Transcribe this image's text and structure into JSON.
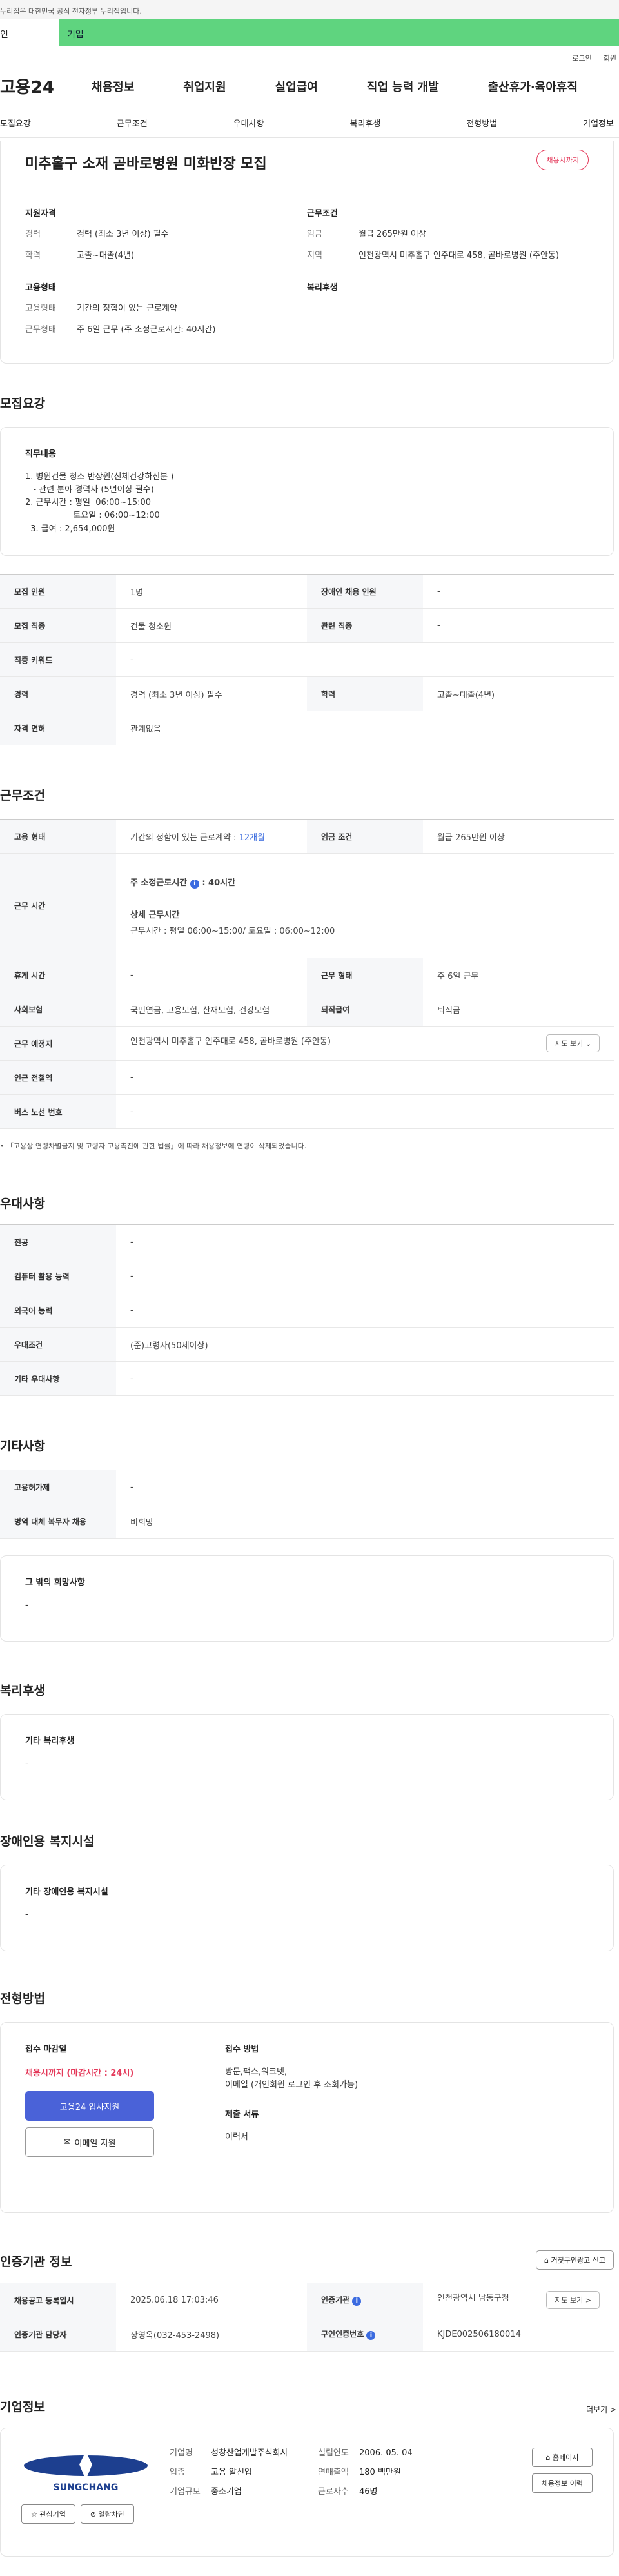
{
  "gov_notice": "누리집은 대한민국 공식 전자정부 누리집입니다.",
  "top_tabs": {
    "individual": "인",
    "corporate": "기업"
  },
  "auth_links": {
    "login": "로그인",
    "signup": "회원"
  },
  "brand": "고용24",
  "main_nav": [
    "채용정보",
    "취업지원",
    "실업급여",
    "직업 능력 개발",
    "출산휴가·육아휴직"
  ],
  "sub_nav": [
    "모집요강",
    "근무조건",
    "우대사항",
    "복리후생",
    "전형방법",
    "기업정보"
  ],
  "summary": {
    "title": "미추홀구 소재 곧바로병원 미화반장 모집",
    "badge": "채용시까지",
    "qual_head": "지원자격",
    "career_k": "경력",
    "career_v": "경력 (최소 3년 이상) 필수",
    "edu_k": "학력",
    "edu_v": "고졸~대졸(4년)",
    "cond_head": "근무조건",
    "wage_k": "임금",
    "wage_v": "월급 265만원 이상",
    "area_k": "지역",
    "area_v": "인천광역시 미추홀구 인주대로 458, 곧바로병원 (주안동)",
    "emp_head": "고용형태",
    "emptype_k": "고용형태",
    "emptype_v": "기간의 정함이 있는 근로계약",
    "worktype_k": "근무형태",
    "worktype_v": "주 6일 근무 (주 소정근로시간: 40시간)",
    "welfare_head": "복리후생"
  },
  "recruit": {
    "section": "모집요강",
    "duty_head": "직무내용",
    "duty_body": "1. 병원건물 청소 반장원(신체건강하신분 )\n   - 관련 분야 경력자 (5년이상 필수)\n2. 근무시간 : 평일  06:00~15:00\n                  토요일 : 06:00~12:00\n  3. 급여 : 2,654,000원",
    "rows": [
      {
        "k1": "모집 인원",
        "v1": "1명",
        "k2": "장애인 채용 인원",
        "v2": "-"
      },
      {
        "k1": "모집 직종",
        "v1": "건물 청소원",
        "k2": "관련 직종",
        "v2": "-"
      },
      {
        "k1": "직종 키워드",
        "v1": "-"
      },
      {
        "k1": "경력",
        "v1": "경력 (최소 3년 이상) 필수",
        "k2": "학력",
        "v2": "고졸~대졸(4년)"
      },
      {
        "k1": "자격 면허",
        "v1": "관계없음"
      }
    ]
  },
  "work": {
    "section": "근무조건",
    "emp_k": "고용 형태",
    "emp_v": "기간의 정함이 있는 근로계약 : ",
    "emp_v_blue": "12개월",
    "wage_k": "임금 조건",
    "wage_v": "월급 265만원 이상",
    "time_k": "근무 시간",
    "weekly_label": "주 소정근로시간",
    "weekly_value": ": 40시간",
    "detail_label": "상세 근무시간",
    "detail_value": "근무시간 : 평일  06:00~15:00/ 토요일 : 06:00~12:00",
    "rest_k": "휴게 시간",
    "rest_v": "-",
    "form_k": "근무 형태",
    "form_v": "주 6일 근무",
    "ins_k": "사회보험",
    "ins_v": "국민연금, 고용보험, 산재보험, 건강보험",
    "ret_k": "퇴직급여",
    "ret_v": "퇴직금",
    "place_k": "근무 예정지",
    "place_v": "인천광역시 미추홀구 인주대로 458, 곧바로병원 (주안동)",
    "map_btn": "지도 보기 ⌄",
    "subway_k": "인근 전철역",
    "subway_v": "-",
    "bus_k": "버스 노선 번호",
    "bus_v": "-",
    "notice": "「고용상 연령차별금지 및 고령자 고용촉진에 관한 법률」에 따라 채용정보에 연령이 삭제되었습니다."
  },
  "prefer": {
    "section": "우대사항",
    "rows": [
      {
        "k": "전공",
        "v": "-"
      },
      {
        "k": "컴퓨터 활용 능력",
        "v": "-"
      },
      {
        "k": "외국어 능력",
        "v": "-"
      },
      {
        "k": "우대조건",
        "v": "(준)고령자(50세이상)"
      },
      {
        "k": "기타 우대사항",
        "v": "-"
      }
    ]
  },
  "etc": {
    "section": "기타사항",
    "rows": [
      {
        "k": "고용허가제",
        "v": "-"
      },
      {
        "k": "병역 대체 복무자 채용",
        "v": "비희망"
      }
    ],
    "other_head": "그 밖의 희망사항",
    "other_body": "-"
  },
  "welfare": {
    "section": "복리후생",
    "head": "기타 복리후생",
    "body": "-"
  },
  "disabled": {
    "section": "장애인용 복지시설",
    "head": "기타 장애인용 복지시설",
    "body": "-"
  },
  "apply": {
    "section": "전형방법",
    "deadline_head": "접수 마감일",
    "deadline_val": "채용시까지 (마감시간 : 24시)",
    "apply_btn": "고용24 입사지원",
    "email_btn": "이메일 지원",
    "method_head": "접수 방법",
    "method_body": "방문,팩스,워크넷,\n이메일 (개인회원 로그인 후 조회가능)",
    "docs_head": "제출 서류",
    "docs_body": "이력서"
  },
  "cert": {
    "section": "인증기관 정보",
    "report_btn": "거짓구인광고 신고",
    "reg_k": "채용공고 등록일시",
    "reg_v": "2025.06.18 17:03:46",
    "agency_k": "인증기관",
    "agency_v": "인천광역시 남동구청",
    "go_btn": "지도 보기 >",
    "mgr_k": "인증기관 담당자",
    "mgr_v": "장영옥(032-453-2498)",
    "cert_k": "구인인증번호",
    "cert_v": "KJDE002506180014"
  },
  "corp": {
    "section": "기업정보",
    "more": "더보기 >",
    "logo_text": "SUNGCHANG",
    "fav_btn": "☆ 관심기업",
    "block_btn": "⊘ 열람차단",
    "name_k": "기업명",
    "name_v": "성창산업개발주식회사",
    "ind_k": "업종",
    "ind_v": "고용 알선업",
    "size_k": "기업규모",
    "size_v": "중소기업",
    "est_k": "설립연도",
    "est_v": "2006. 05. 04",
    "sales_k": "연매출액",
    "sales_v": "180 백만원",
    "emp_k": "근로자수",
    "emp_v": "46명",
    "home_btn": "홈페이지",
    "history_btn": "채용정보 이력"
  }
}
